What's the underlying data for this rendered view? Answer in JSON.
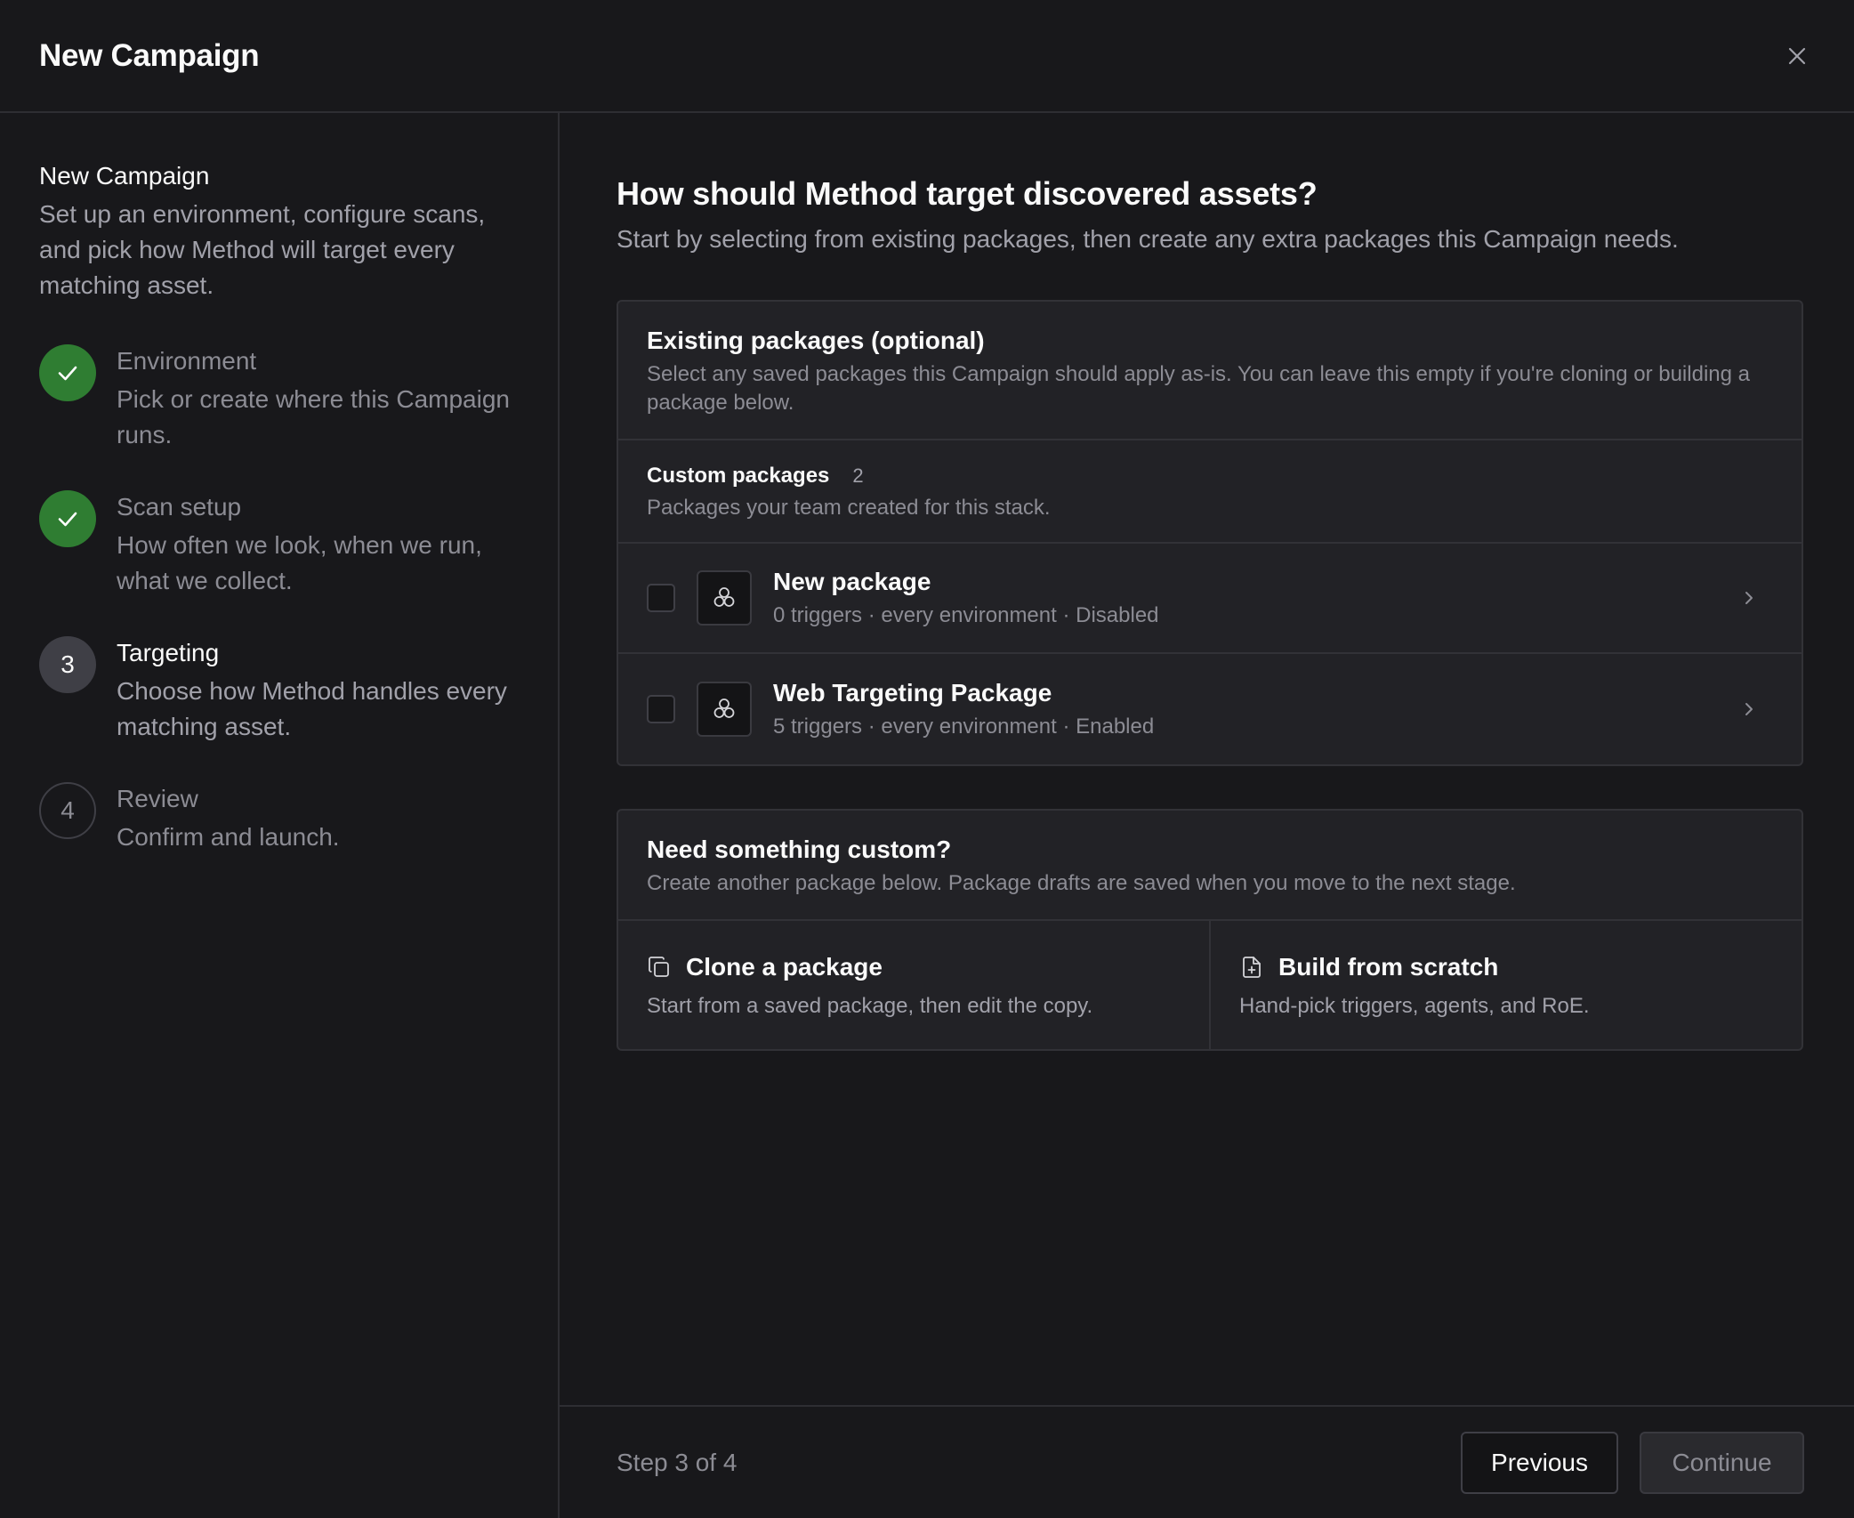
{
  "header": {
    "title": "New Campaign"
  },
  "sidebar": {
    "title": "New Campaign",
    "description": "Set up an environment, configure scans, and pick how Method will target every matching asset.",
    "steps": [
      {
        "marker": "",
        "status": "done",
        "title": "Environment",
        "description": "Pick or create where this Campaign runs."
      },
      {
        "marker": "",
        "status": "done",
        "title": "Scan setup",
        "description": "How often we look, when we run, what we collect."
      },
      {
        "marker": "3",
        "status": "current",
        "title": "Targeting",
        "description": "Choose how Method handles every matching asset."
      },
      {
        "marker": "4",
        "status": "pending",
        "title": "Review",
        "description": "Confirm and launch."
      }
    ]
  },
  "main": {
    "title": "How should Method target discovered assets?",
    "subtitle": "Start by selecting from existing packages, then create any extra packages this Campaign needs.",
    "existing": {
      "title": "Existing packages (optional)",
      "description": "Select any saved packages this Campaign should apply as-is. You can leave this empty if you're cloning or building a package below.",
      "group_title": "Custom packages",
      "group_count": "2",
      "group_description": "Packages your team created for this stack.",
      "packages": [
        {
          "name": "New package",
          "meta": "0 triggers · every environment · Disabled",
          "checked": false
        },
        {
          "name": "Web Targeting Package",
          "meta": "5 triggers · every environment · Enabled",
          "checked": false
        }
      ]
    },
    "custom": {
      "title": "Need something custom?",
      "description": "Create another package below. Package drafts are saved when you move to the next stage.",
      "options": [
        {
          "icon": "copy-icon",
          "title": "Clone a package",
          "description": "Start from a saved package, then edit the copy."
        },
        {
          "icon": "file-plus-icon",
          "title": "Build from scratch",
          "description": "Hand-pick triggers, agents, and RoE."
        }
      ]
    }
  },
  "footer": {
    "step_label": "Step 3 of 4",
    "previous_label": "Previous",
    "continue_label": "Continue"
  },
  "colors": {
    "background": "#18181b",
    "card": "#222226",
    "success": "#2f7d32",
    "border": "#323237"
  }
}
